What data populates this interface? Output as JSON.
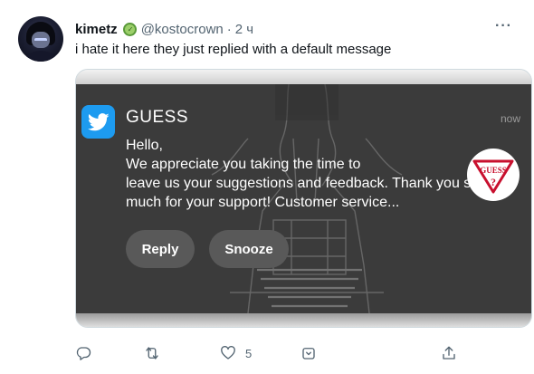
{
  "tweet": {
    "author_name": "kimetz",
    "author_handle": "@kostocrown",
    "separator": "·",
    "time": "2 ч",
    "more_label": "···",
    "text": "i hate it here they just replied with a default message",
    "badge_icon": "emoji-badge-icon"
  },
  "notification": {
    "app_icon": "twitter-bird-icon",
    "app_name": "GUESS",
    "time": "now",
    "message": "Hello,\n We appreciate you taking the time to\nleave us your suggestions and feedback. Thank you so\nmuch for your support! Customer service...",
    "logo_text": "GUESS",
    "logo_mark": "?",
    "buttons": {
      "reply": "Reply",
      "snooze": "Snooze"
    },
    "colors": {
      "card_bg": "#3b3b3b",
      "button_bg": "#595959",
      "twitter_blue": "#1d9bf0",
      "guess_red": "#c8102e"
    }
  },
  "actions": {
    "reply_icon": "reply-icon",
    "retweet_icon": "retweet-icon",
    "like_icon": "like-icon",
    "like_count": "5",
    "bookmark_icon": "bookmark-icon",
    "share_icon": "share-icon"
  }
}
